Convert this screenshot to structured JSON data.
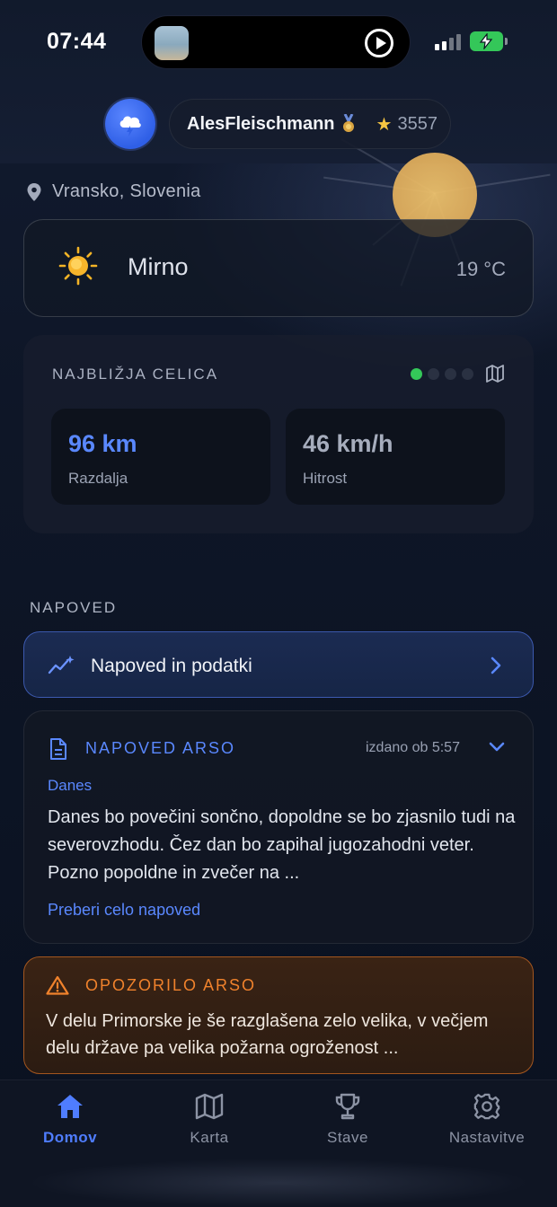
{
  "status_bar": {
    "time": "07:44"
  },
  "header": {
    "username": "AlesFleischmann",
    "points": "3557",
    "avatar_icon": "storm-cloud-icon",
    "badge_icon": "medal-icon"
  },
  "location": {
    "text": "Vransko, Slovenia"
  },
  "weather": {
    "condition": "Mirno",
    "temperature": "19 °C",
    "icon": "sun-icon"
  },
  "nearest_cell": {
    "title": "NAJBLIŽJA CELICA",
    "page_dots": 4,
    "active_dot": 0,
    "distance_value": "96 km",
    "distance_label": "Razdalja",
    "speed_value": "46 km/h",
    "speed_label": "Hitrost"
  },
  "forecast_section": {
    "label": "NAPOVED",
    "button_label": "Napoved in podatki"
  },
  "arso_forecast": {
    "title": "NAPOVED ARSO",
    "issued": "izdano ob 5:57",
    "day": "Danes",
    "body": "Danes bo povečini sončno, dopoldne se bo zjasnilo tudi na severovzhodu. Čez dan bo zapihal jugozahodni veter. Pozno popoldne in zvečer na ...",
    "link": "Preberi celo napoved"
  },
  "arso_warning": {
    "title": "OPOZORILO ARSO",
    "body": "V delu Primorske je še razglašena zelo velika, v večjem delu države pa velika požarna ogroženost ..."
  },
  "tabbar": {
    "tabs": [
      {
        "label": "Domov",
        "icon": "home-icon",
        "active": true
      },
      {
        "label": "Karta",
        "icon": "map-icon",
        "active": false
      },
      {
        "label": "Stave",
        "icon": "trophy-icon",
        "active": false
      },
      {
        "label": "Nastavitve",
        "icon": "gear-icon",
        "active": false
      }
    ]
  },
  "colors": {
    "accent": "#4f7dff",
    "warning": "#f0822c",
    "success": "#34c759"
  }
}
